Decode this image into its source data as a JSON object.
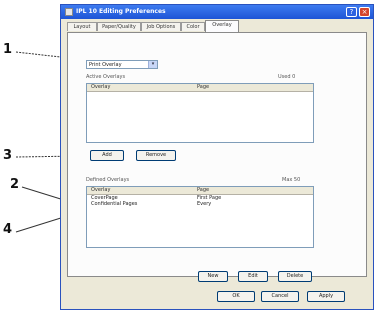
{
  "window": {
    "title": "IPL 10 Editing Preferences",
    "help_glyph": "?",
    "close_glyph": "×"
  },
  "tabs": [
    "Layout",
    "Paper/Quality",
    "Job Options",
    "Color",
    "Overlay"
  ],
  "dropdown": {
    "value": "Print Overlay",
    "arrow": "▾"
  },
  "active_overlays": {
    "label": "Active Overlays",
    "right_label": "Used 0",
    "columns": [
      "Overlay",
      "Page"
    ],
    "rows": []
  },
  "buttons_top": {
    "add": "Add",
    "remove": "Remove"
  },
  "defined_overlays": {
    "label": "Defined Overlays",
    "right_label": "Max 50",
    "columns": [
      "Overlay",
      "Page"
    ],
    "rows": [
      {
        "name": "CoverPage",
        "page": "First Page"
      },
      {
        "name": "Confidential Pages",
        "page": "Every"
      }
    ]
  },
  "buttons_list": {
    "new": "New",
    "edit": "Edit",
    "delete": "Delete"
  },
  "buttons_bottom": {
    "ok": "OK",
    "cancel": "Cancel",
    "apply": "Apply"
  },
  "callouts": [
    "1",
    "3",
    "2",
    "4"
  ]
}
